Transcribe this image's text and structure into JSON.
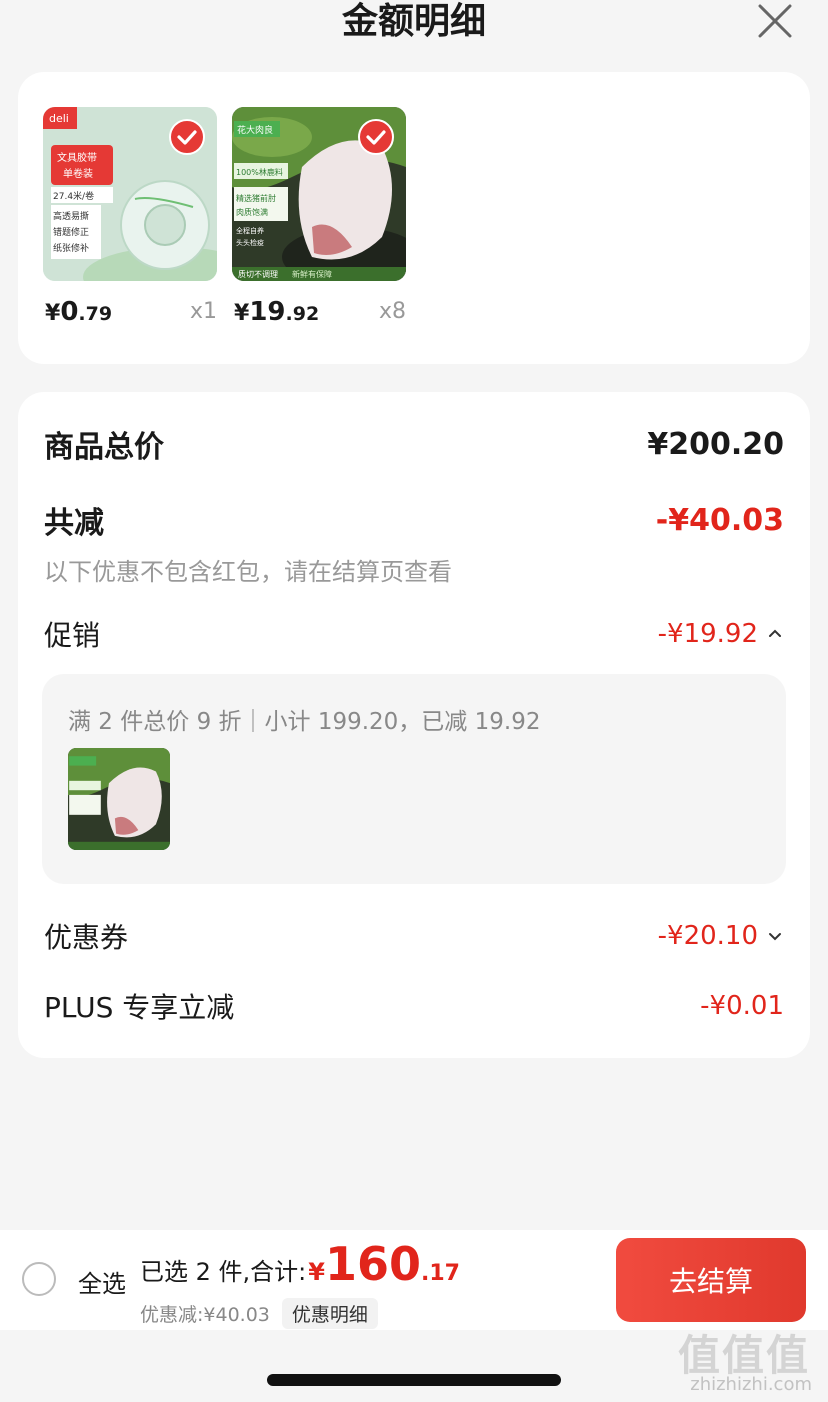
{
  "header": {
    "title": "金额明细",
    "close_icon": "close-icon"
  },
  "products": [
    {
      "price_currency": "¥",
      "price_int": "0",
      "price_dec": ".79",
      "qty": "x1",
      "thumb_brand": "deli",
      "thumb_lines": [
        "文具胶带",
        "单卷装",
        "27.4米/卷",
        "高透易撕",
        "错题修正",
        "纸张修补"
      ]
    },
    {
      "price_currency": "¥",
      "price_int": "19",
      "price_dec": ".92",
      "qty": "x8",
      "thumb_brand": "花大肉良",
      "thumb_lines": [
        "100%林鹿料",
        "精选猪前肘",
        "肉质饱满",
        "全程自养",
        "头头检疫",
        "质切不调理",
        "新鲜有保障"
      ]
    }
  ],
  "summary": {
    "total_label": "商品总价",
    "total_value": "¥200.20",
    "reduce_label": "共减",
    "reduce_value": "-¥40.03",
    "note": "以下优惠不包含红包，请在结算页查看",
    "promo_label": "促销",
    "promo_value": "-¥19.92",
    "promo_detail": "满 2 件总价 9 折｜小计 199.20，已减 19.92",
    "coupon_label": "优惠券",
    "coupon_value": "-¥20.10",
    "plus_label": "PLUS 专享立减",
    "plus_value": "-¥0.01"
  },
  "bottom_bar": {
    "select_all": "全选",
    "selected_prefix": "已选 2 件,合计:",
    "total_currency": "¥",
    "total_int": "160",
    "total_dec": ".17",
    "discount_text": "优惠减:¥40.03",
    "detail_chip": "优惠明细",
    "checkout_label": "去结算"
  },
  "watermark": {
    "logo": "值值值",
    "site": "zhizhizhi.com"
  },
  "colors": {
    "accent_red": "#e1251b",
    "checkout_bg": "#ef4137",
    "card_bg": "#ffffff",
    "page_bg": "#f5f5f5"
  }
}
